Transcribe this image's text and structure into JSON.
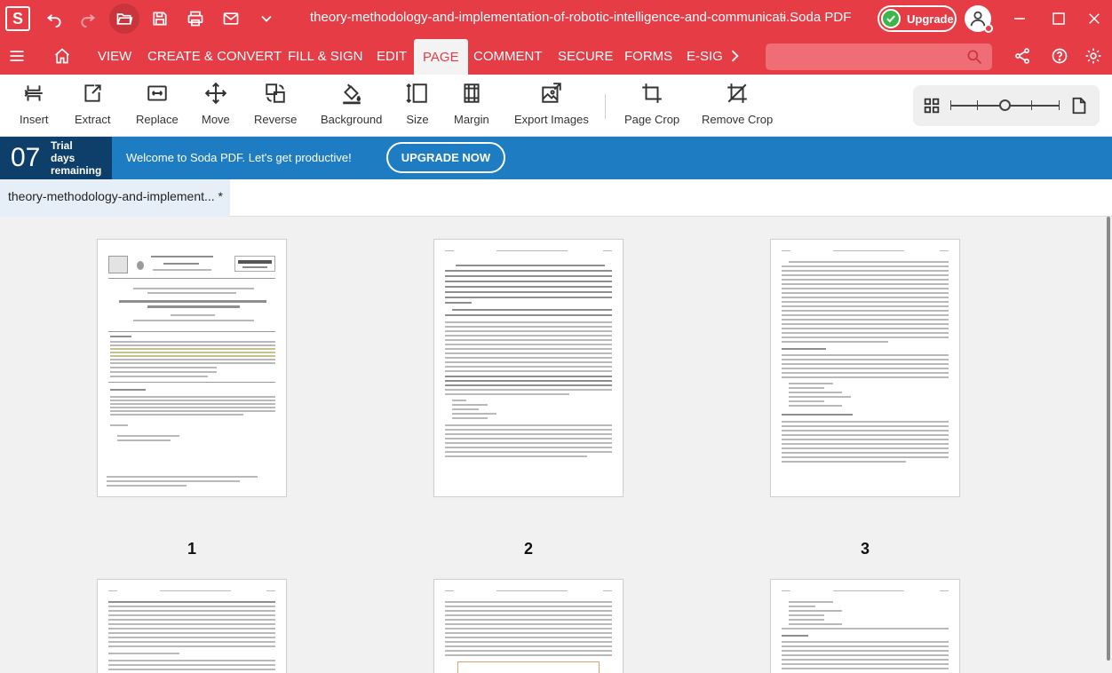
{
  "titlebar": {
    "app_logo": "S",
    "document_title": "theory-methodology-and-implementation-of-robotic-intelligence-and-communicati...",
    "app_name": "-    Soda PDF",
    "upgrade_label": "Upgrade"
  },
  "menu": {
    "items": [
      "VIEW",
      "CREATE & CONVERT",
      "FILL & SIGN",
      "EDIT",
      "PAGE",
      "COMMENT",
      "SECURE",
      "FORMS",
      "E-SIG"
    ],
    "active": "PAGE",
    "search_placeholder": ""
  },
  "ribbon": {
    "tools": [
      {
        "label": "Insert",
        "icon": "insert-icon"
      },
      {
        "label": "Extract",
        "icon": "extract-icon"
      },
      {
        "label": "Replace",
        "icon": "replace-icon"
      },
      {
        "label": "Move",
        "icon": "move-icon"
      },
      {
        "label": "Reverse",
        "icon": "reverse-icon"
      },
      {
        "label": "Background",
        "icon": "paint-bucket-icon"
      },
      {
        "label": "Size",
        "icon": "size-icon"
      },
      {
        "label": "Margin",
        "icon": "margin-icon"
      },
      {
        "label": "Export Images",
        "icon": "export-images-icon"
      },
      {
        "label": "Page Crop",
        "icon": "crop-icon"
      },
      {
        "label": "Remove Crop",
        "icon": "remove-crop-icon"
      }
    ]
  },
  "trial": {
    "days": "07",
    "line1": "Trial",
    "line2": "days",
    "line3": "remaining",
    "welcome": "Welcome to Soda PDF. Let's get productive!",
    "upgrade_now": "UPGRADE NOW"
  },
  "doc_tab": {
    "label": "theory-methodology-and-implement... *"
  },
  "pages": {
    "numbers": [
      "1",
      "2",
      "3"
    ]
  },
  "colors": {
    "brand_red": "#e63c46",
    "banner_blue": "#1e7dc2",
    "banner_dark": "#0e3f6b",
    "upgrade_green": "#3cb54a"
  }
}
